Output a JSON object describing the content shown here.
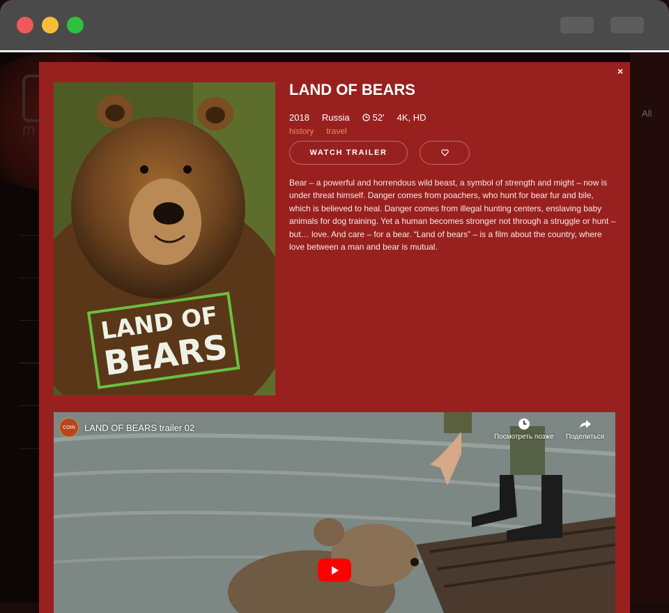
{
  "browser": {
    "controls": [
      "close",
      "minimize",
      "maximize"
    ]
  },
  "background_page": {
    "filter_label": "All",
    "logo_letter": "m"
  },
  "modal": {
    "close_icon": "×",
    "title": "LAND OF BEARS",
    "year": "2018",
    "country": "Russia",
    "duration": "52'",
    "quality": "4K, HD",
    "genres": [
      "history",
      "travel"
    ],
    "watch_trailer_label": "WATCH TRAILER",
    "favorite_icon": "heart-icon",
    "description": "Bear – a powerful and horrendous wild beast, a symbol of strength and might – now is under threat himself. Danger comes from poachers, who hunt for bear fur and bile, which is believed to heal. Danger comes from illegal hunting centers, enslaving baby animals for dog training. Yet a human becomes stronger not through a struggle or hunt – but… love. And care – for a bear. “Land of bears” – is a film about the country, where love between a man and bear is mutual.",
    "poster_text": [
      "LAND OF",
      "BEARS"
    ]
  },
  "video": {
    "channel_badge": "COIN",
    "title": "LAND OF BEARS trailer 02",
    "watch_later_label": "Посмотреть позже",
    "share_label": "Поделиться"
  },
  "colors": {
    "modal_bg": "#98211f",
    "genre_accent": "#f08a5d",
    "youtube_red": "#ff0000"
  }
}
